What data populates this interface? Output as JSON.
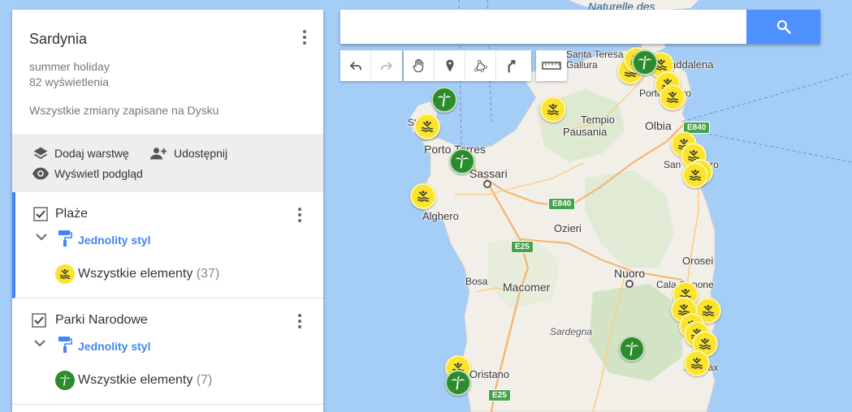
{
  "panel": {
    "title": "Sardynia",
    "description": "summer holiday",
    "views": "82 wyświetlenia",
    "saved_status": "Wszystkie zmiany zapisane na Dysku",
    "actions": {
      "add_layer": "Dodaj warstwę",
      "share": "Udostępnij",
      "preview": "Wyświetl podgląd"
    },
    "layers": [
      {
        "name": "Plaże",
        "style": "Jednolity styl",
        "all_label": "Wszystkie elementy",
        "count": "(37)",
        "icon": "beach-icon"
      },
      {
        "name": "Parki Narodowe",
        "style": "Jednolity styl",
        "all_label": "Wszystkie elementy",
        "count": "(7)",
        "icon": "palm-tree-icon"
      }
    ]
  },
  "search": {
    "value": "",
    "placeholder": ""
  },
  "toolbar": [
    "undo-icon",
    "redo-icon",
    "hand-icon",
    "marker-icon",
    "draw-line-icon",
    "directions-icon",
    "ruler-icon"
  ],
  "map": {
    "labels": {
      "sea_top": "Naturelle des",
      "santa_teresa": "Santa Teresa",
      "gallura": "Gallura",
      "maddalena": "addalena",
      "porto_cervo": "Porto Cervo",
      "tempio": "Tempio",
      "pausania": "Pausania",
      "olbia": "Olbia",
      "san_teodoro": "San Teodoro",
      "porto_torres": "Porto Torres",
      "stintino": "Stintino",
      "sassari": "Sassari",
      "alghero": "Alghero",
      "ozieri": "Ozieri",
      "orosei": "Orosei",
      "nuoro": "Nuoro",
      "bosa": "Bosa",
      "macomer": "Macomer",
      "cala_gonone": "Cala Gonone",
      "sardegna": "Sardegna",
      "oristano": "Oristano",
      "arbatax": "Arbatax"
    },
    "roads": {
      "e840_a": "E840",
      "e840_b": "E840",
      "e25_a": "E25",
      "e25_b": "E25"
    }
  },
  "colors": {
    "accent": "#4285f4",
    "beach": "#fbe42b",
    "park": "#2c8b2e",
    "water": "#a4cdf7",
    "land": "#f2efe9"
  }
}
